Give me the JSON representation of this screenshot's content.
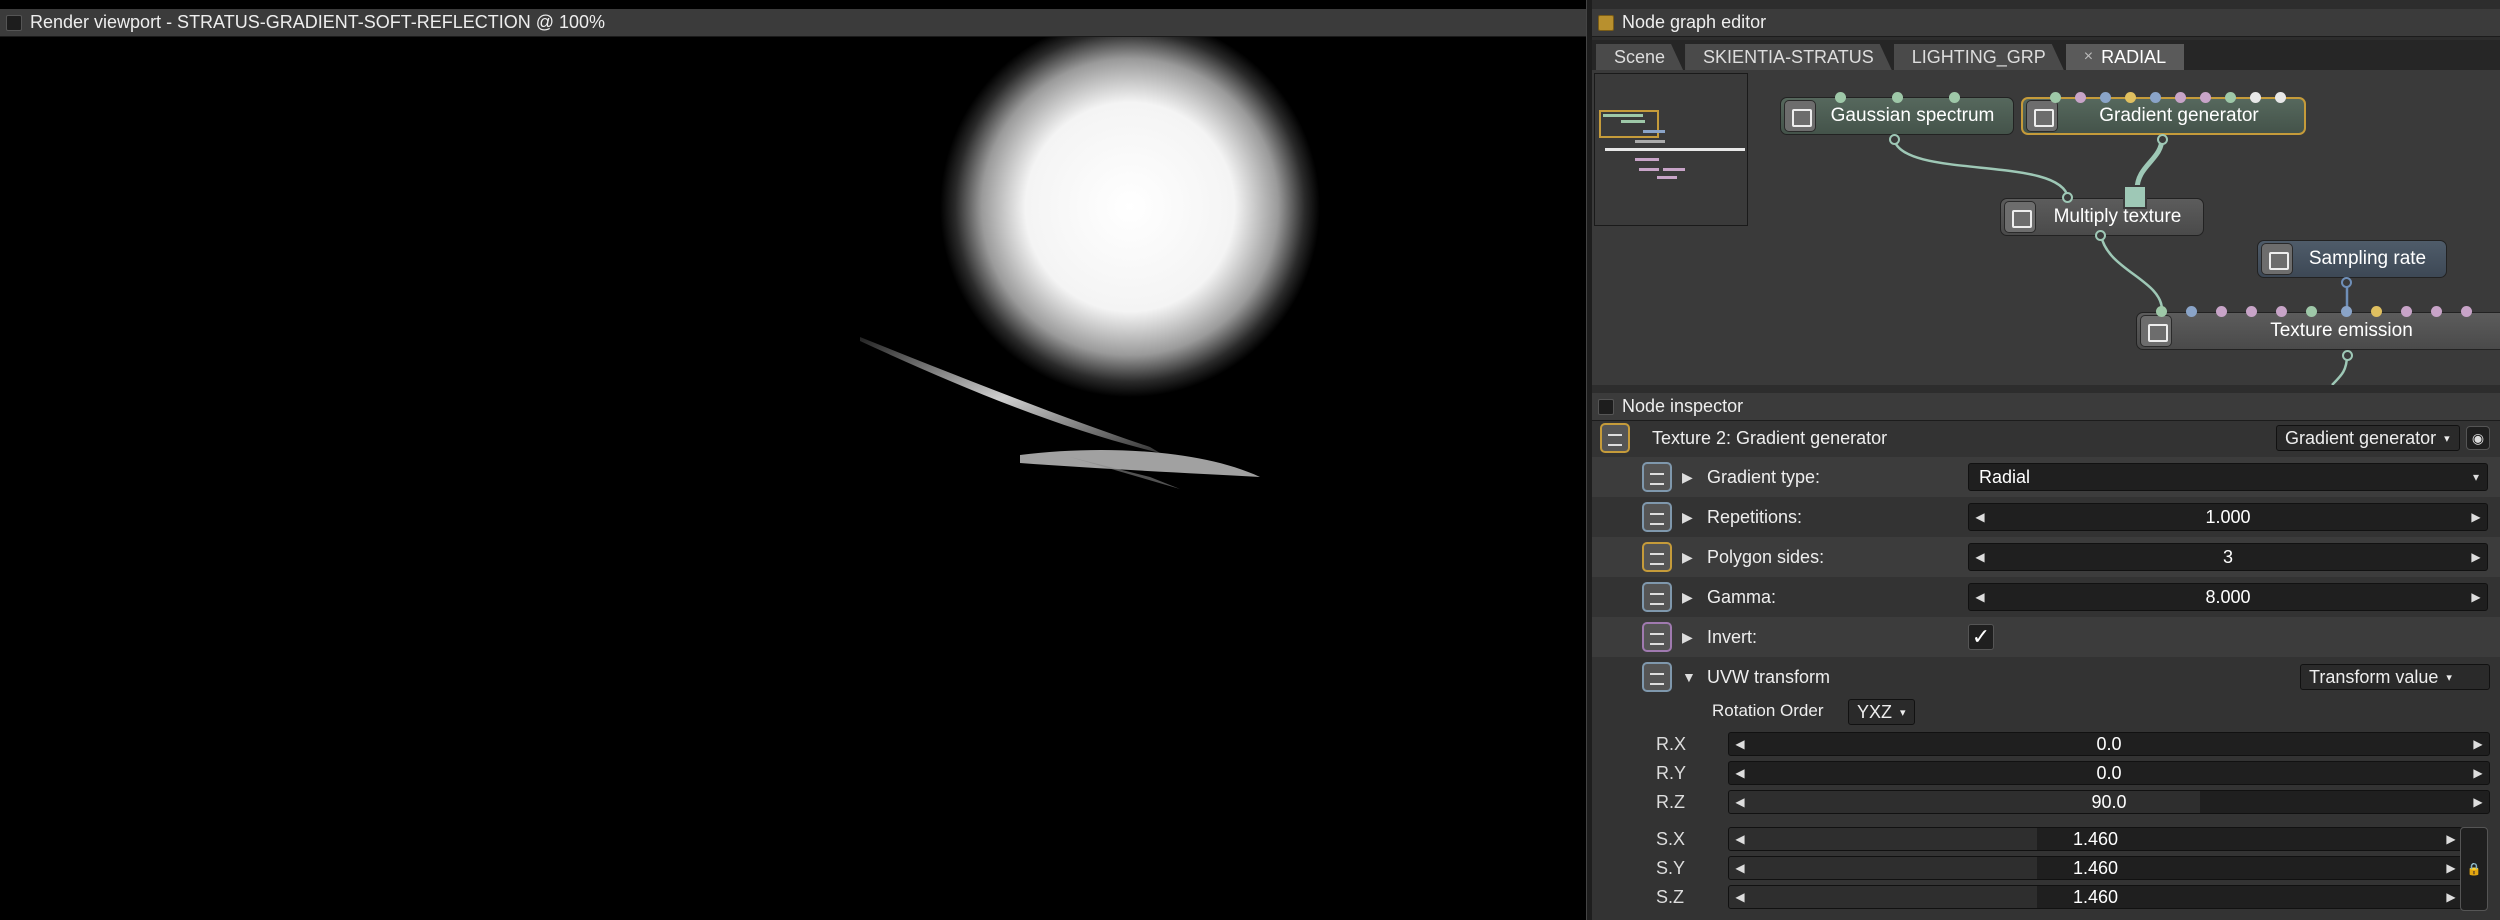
{
  "viewport": {
    "title": "Render viewport - STRATUS-GRADIENT-SOFT-REFLECTION @ 100%"
  },
  "node_graph": {
    "title": "Node graph editor",
    "tabs": [
      "Scene",
      "SKIENTIA-STRATUS",
      "LIGHTING_GRP",
      "RADIAL"
    ],
    "close_glyph": "×",
    "nodes": {
      "gaussian": "Gaussian spectrum",
      "gradient": "Gradient generator",
      "multiply": "Multiply texture",
      "sampling": "Sampling rate",
      "emission": "Texture emission"
    }
  },
  "inspector": {
    "title": "Node inspector",
    "header_label": "Texture 2: Gradient generator",
    "node_type_select": "Gradient generator",
    "params": {
      "gradient_type": {
        "label": "Gradient type:",
        "value": "Radial"
      },
      "repetitions": {
        "label": "Repetitions:",
        "value": "1.000"
      },
      "polygon_sides": {
        "label": "Polygon sides:",
        "value": "3"
      },
      "gamma": {
        "label": "Gamma:",
        "value": "8.000"
      },
      "invert": {
        "label": "Invert:",
        "checked": true,
        "glyph": "✓"
      },
      "uvw": {
        "label": "UVW transform",
        "mode": "Transform value"
      }
    },
    "rotation_order": {
      "label": "Rotation Order",
      "value": "YXZ"
    },
    "transform": {
      "rx": {
        "label": "R.X",
        "value": "0.0",
        "level": 0.0
      },
      "ry": {
        "label": "R.Y",
        "value": "0.0",
        "level": 0.0
      },
      "rz": {
        "label": "R.Z",
        "value": "90.0",
        "level": 0.62
      },
      "sx": {
        "label": "S.X",
        "value": "1.460",
        "level": 0.42
      },
      "sy": {
        "label": "S.Y",
        "value": "1.460",
        "level": 0.42
      },
      "sz": {
        "label": "S.Z",
        "value": "1.460",
        "level": 0.42
      }
    }
  },
  "icons": {
    "expanded": "▼",
    "collapsed": "▶",
    "arrow_left": "◀",
    "arrow_right": "▶",
    "dropdown": "▾",
    "lock": "🔒",
    "eye": "◉"
  }
}
